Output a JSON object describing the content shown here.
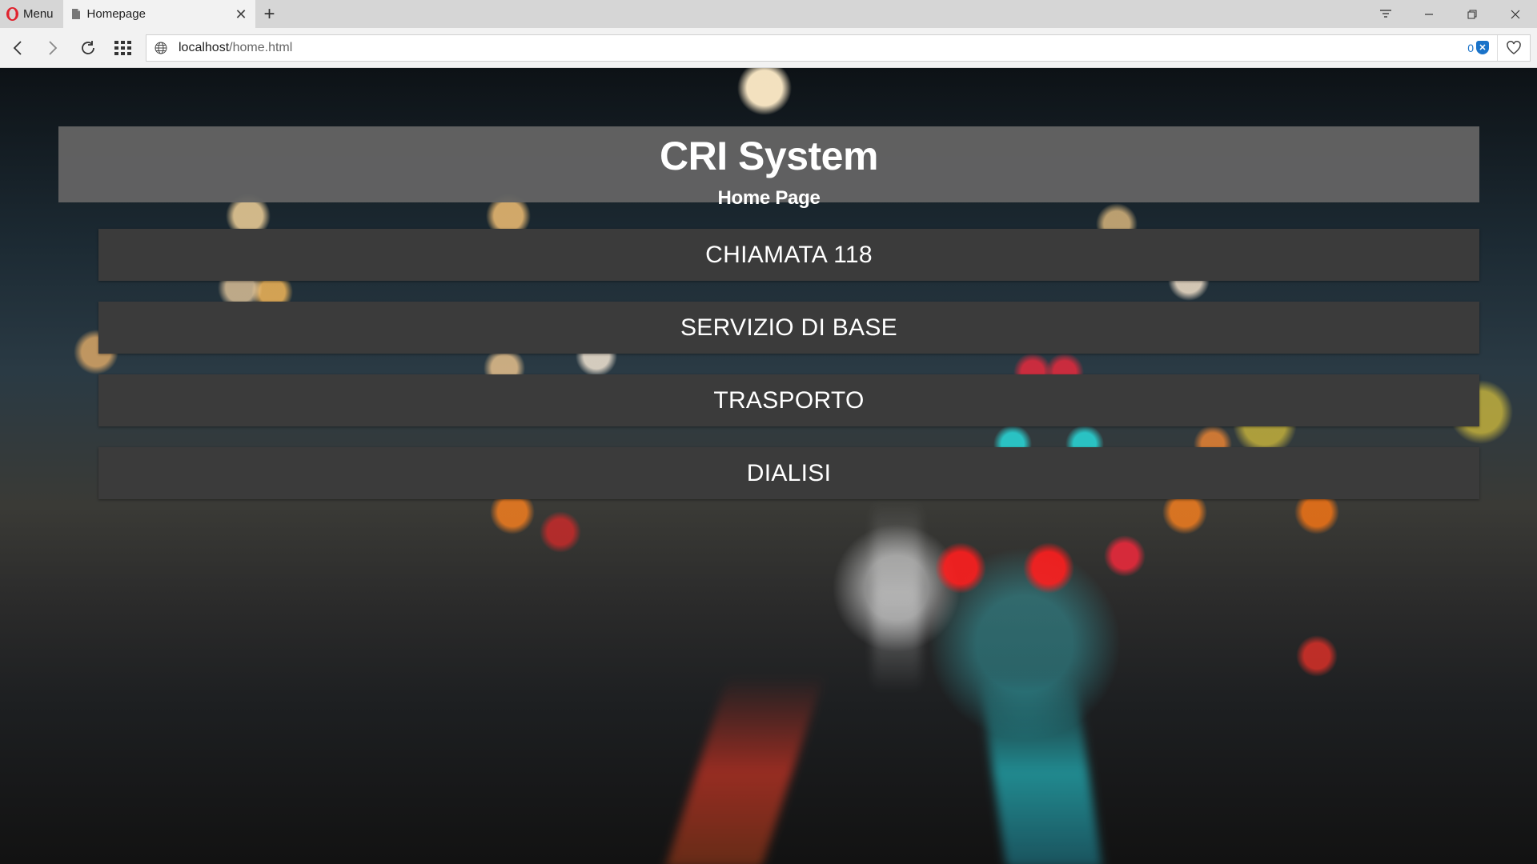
{
  "browser": {
    "menu_label": "Menu",
    "tab_title": "Homepage",
    "new_tab_symbol": "+",
    "url_host": "localhost",
    "url_path": "/home.html",
    "blocked_count": "0"
  },
  "page": {
    "title": "CRI System",
    "subtitle": "Home Page",
    "menu": [
      {
        "label": "CHIAMATA 118"
      },
      {
        "label": "SERVIZIO DI BASE"
      },
      {
        "label": "TRASPORTO"
      },
      {
        "label": "DIALISI"
      }
    ]
  },
  "icons": {
    "browser_logo": "opera-logo-icon",
    "tab_icon": "document-icon",
    "tab_close": "close-icon",
    "back": "back-arrow-icon",
    "forward": "forward-arrow-icon",
    "reload": "reload-icon",
    "speed_dial": "grid-icon",
    "site_info": "globe-icon",
    "ad_blocker": "shield-icon",
    "bookmark": "heart-icon"
  },
  "colors": {
    "header_bg": "#646464",
    "menu_item_bg": "#3b3b3b",
    "text": "#ffffff"
  }
}
